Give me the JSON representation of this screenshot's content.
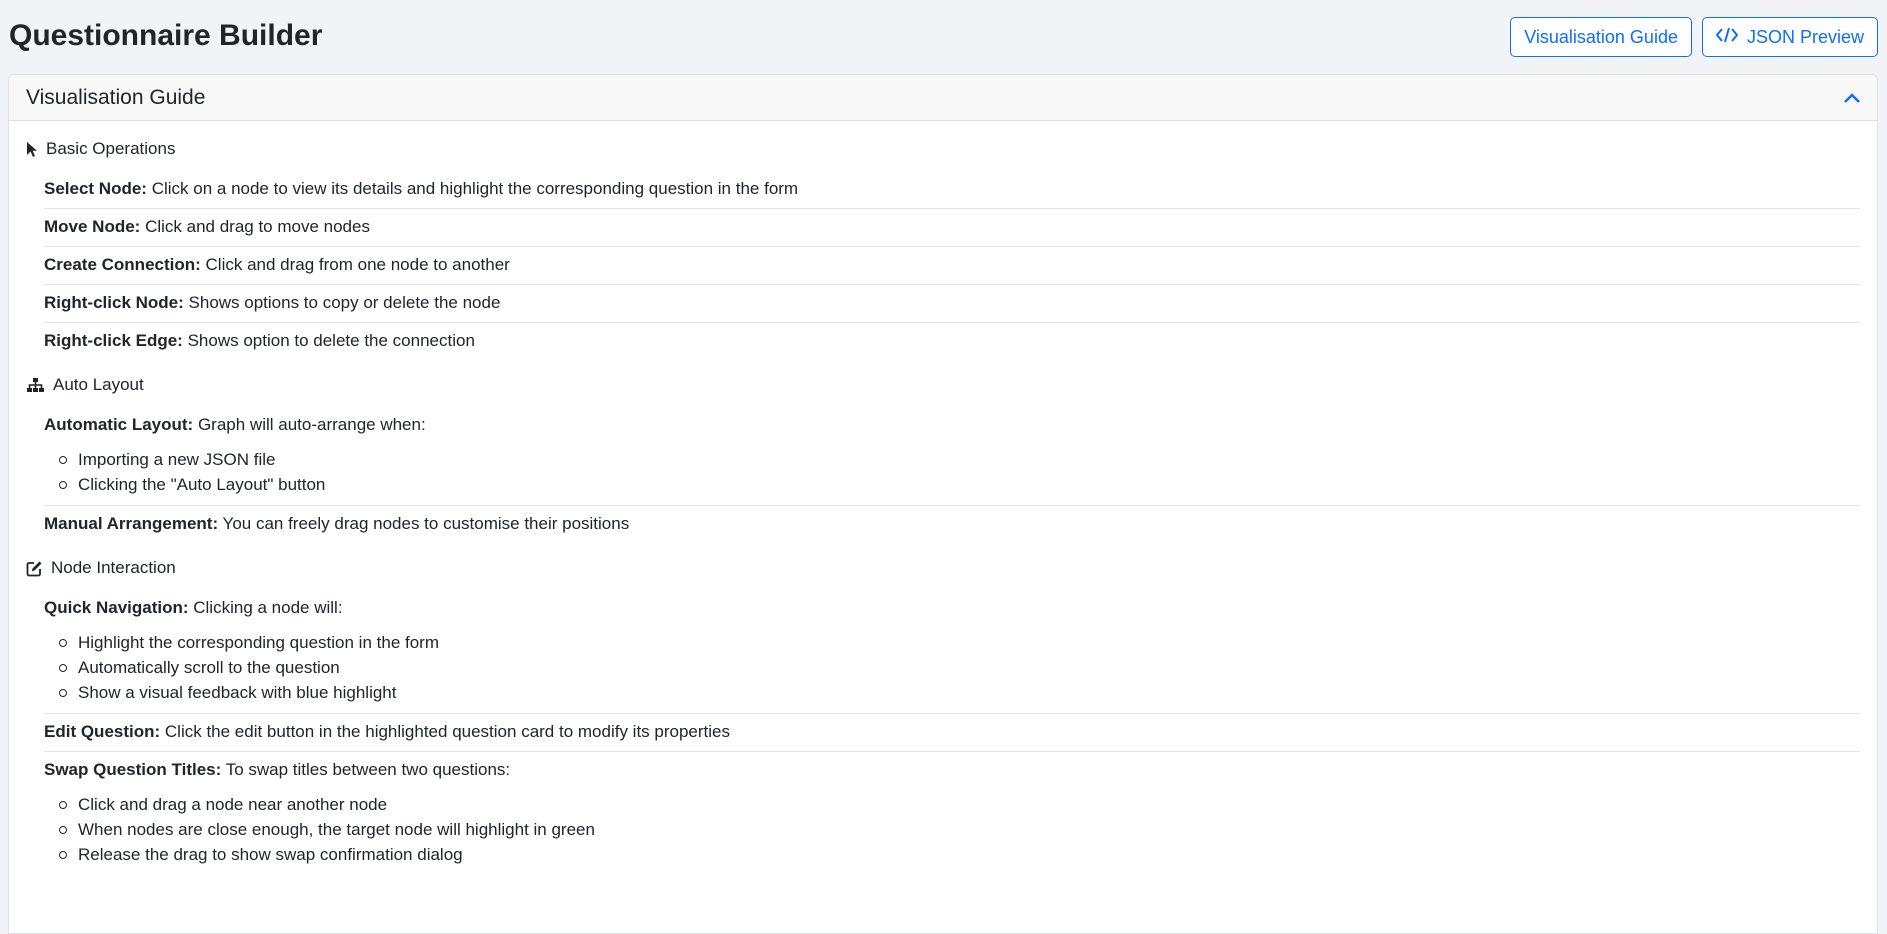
{
  "header": {
    "title": "Questionnaire Builder",
    "visualisation_button": "Visualisation Guide",
    "json_button": "JSON Preview"
  },
  "guide": {
    "title": "Visualisation Guide",
    "sections": [
      {
        "title": "Basic Operations",
        "icon": "cursor-pointer-icon",
        "items": [
          {
            "label": "Select Node:",
            "text": " Click on a node to view its details and highlight the corresponding question in the form"
          },
          {
            "label": "Move Node:",
            "text": " Click and drag to move nodes"
          },
          {
            "label": "Create Connection:",
            "text": " Click and drag from one node to another"
          },
          {
            "label": "Right-click Node:",
            "text": " Shows options to copy or delete the node"
          },
          {
            "label": "Right-click Edge:",
            "text": " Shows option to delete the connection"
          }
        ]
      },
      {
        "title": "Auto Layout",
        "icon": "sitemap-icon",
        "items": [
          {
            "label": "Automatic Layout:",
            "text": " Graph will auto-arrange when:",
            "bullets": [
              "Importing a new JSON file",
              "Clicking the \"Auto Layout\" button"
            ]
          },
          {
            "label": "Manual Arrangement:",
            "text": " You can freely drag nodes to customise their positions"
          }
        ]
      },
      {
        "title": "Node Interaction",
        "icon": "edit-icon",
        "items": [
          {
            "label": "Quick Navigation:",
            "text": " Clicking a node will:",
            "bullets": [
              "Highlight the corresponding question in the form",
              "Automatically scroll to the question",
              "Show a visual feedback with blue highlight"
            ]
          },
          {
            "label": "Edit Question:",
            "text": " Click the edit button in the highlighted question card to modify its properties"
          },
          {
            "label": "Swap Question Titles:",
            "text": " To swap titles between two questions:",
            "bullets": [
              "Click and drag a node near another node",
              "When nodes are close enough, the target node will highlight in green",
              "Release the drag to show swap confirmation dialog"
            ]
          }
        ]
      }
    ]
  },
  "colors": {
    "accent": "#0d6efd",
    "background": "#f1f3f6",
    "card_header": "#f8f8f8"
  }
}
